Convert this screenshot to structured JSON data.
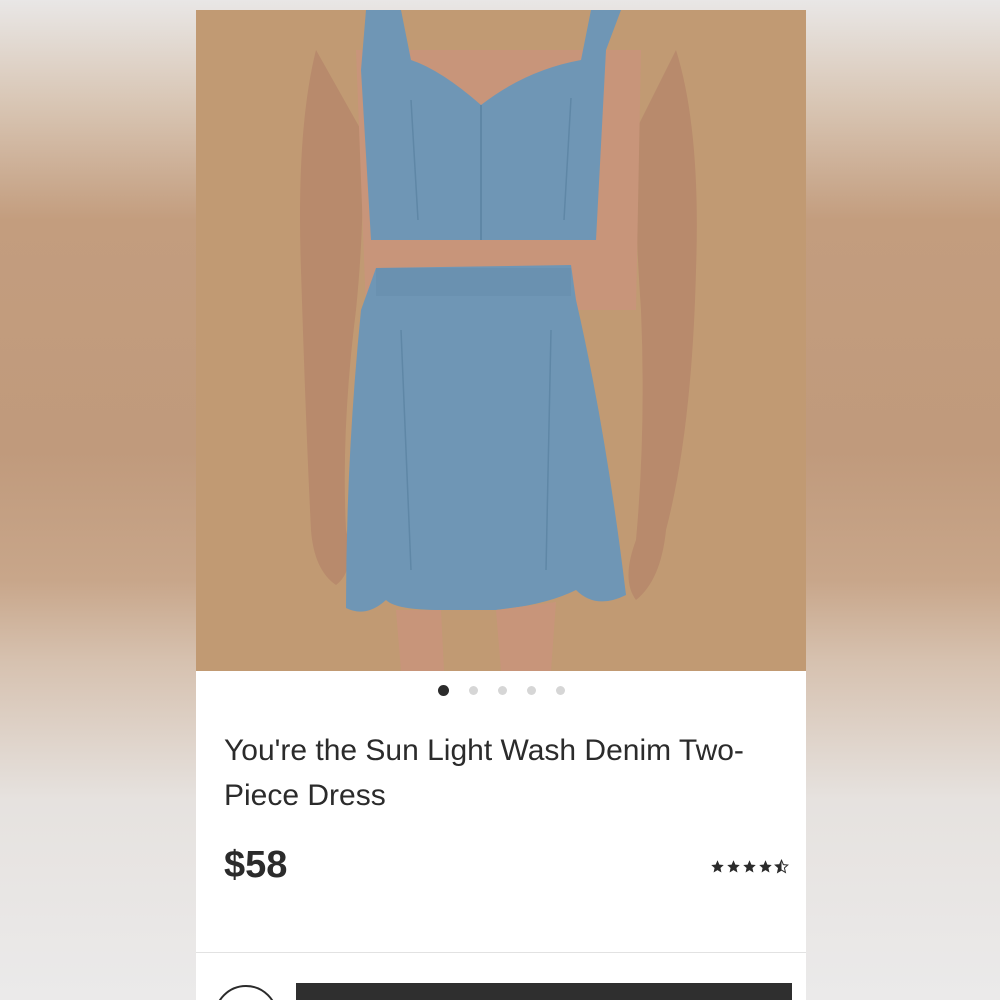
{
  "product": {
    "title": "You're the Sun Light Wash Denim Two-Piece Dress",
    "price": "$58",
    "rating": 4.5,
    "rating_max": 5,
    "image_alt": "Model wearing light wash denim crop top and mini skirt"
  },
  "carousel": {
    "count": 5,
    "active_index": 0
  },
  "colors": {
    "denim": "#6f96b5",
    "backdrop": "#c19a73",
    "text": "#2b2b2b"
  },
  "icons": {
    "star": "star-icon",
    "half_star": "half-star-icon"
  }
}
